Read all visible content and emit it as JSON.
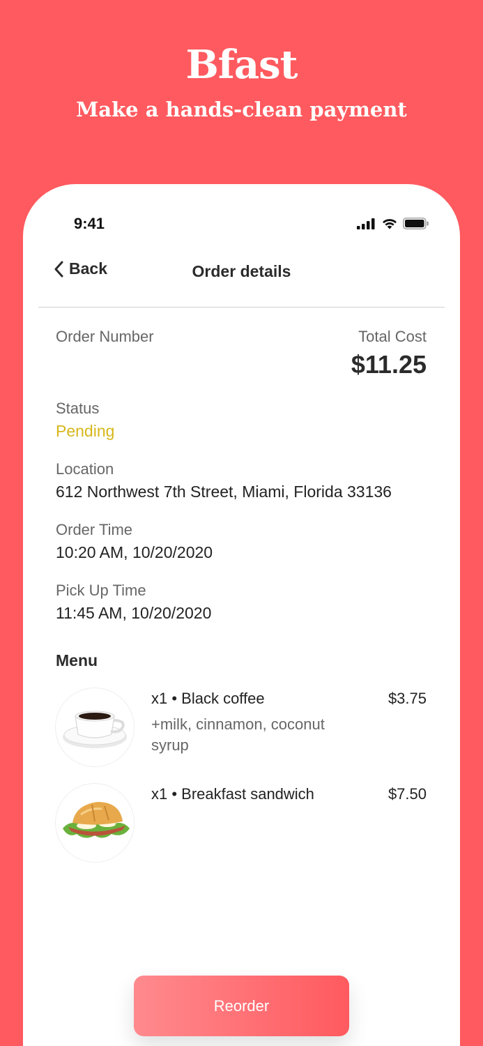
{
  "hero": {
    "title": "Bfast",
    "subtitle": "Make a hands-clean payment"
  },
  "status_bar": {
    "time": "9:41",
    "icons": [
      "signal-icon",
      "wifi-icon",
      "battery-icon"
    ]
  },
  "nav": {
    "back_label": "Back",
    "title": "Order details"
  },
  "order": {
    "number_label": "Order Number",
    "total_cost_label": "Total Cost",
    "total_cost": "$11.25",
    "status_label": "Status",
    "status": "Pending",
    "location_label": "Location",
    "location": "612 Northwest 7th Street, Miami, Florida 33136",
    "order_time_label": "Order Time",
    "order_time": "10:20 AM, 10/20/2020",
    "pickup_time_label": "Pick Up Time",
    "pickup_time": "11:45 AM, 10/20/2020"
  },
  "menu": {
    "heading": "Menu",
    "items": [
      {
        "name": "x1 • Black coffee",
        "modifiers": "+milk, cinnamon, coconut syrup",
        "price": "$3.75",
        "icon": "coffee-cup-image"
      },
      {
        "name": "x1 • Breakfast sandwich",
        "modifiers": "",
        "price": "$7.50",
        "icon": "sandwich-image"
      }
    ]
  },
  "actions": {
    "reorder_label": "Reorder"
  },
  "colors": {
    "brand": "#FF5A5F",
    "pending": "#D6B71C",
    "text_dark": "#2B2B2B",
    "text_muted": "#666666"
  }
}
